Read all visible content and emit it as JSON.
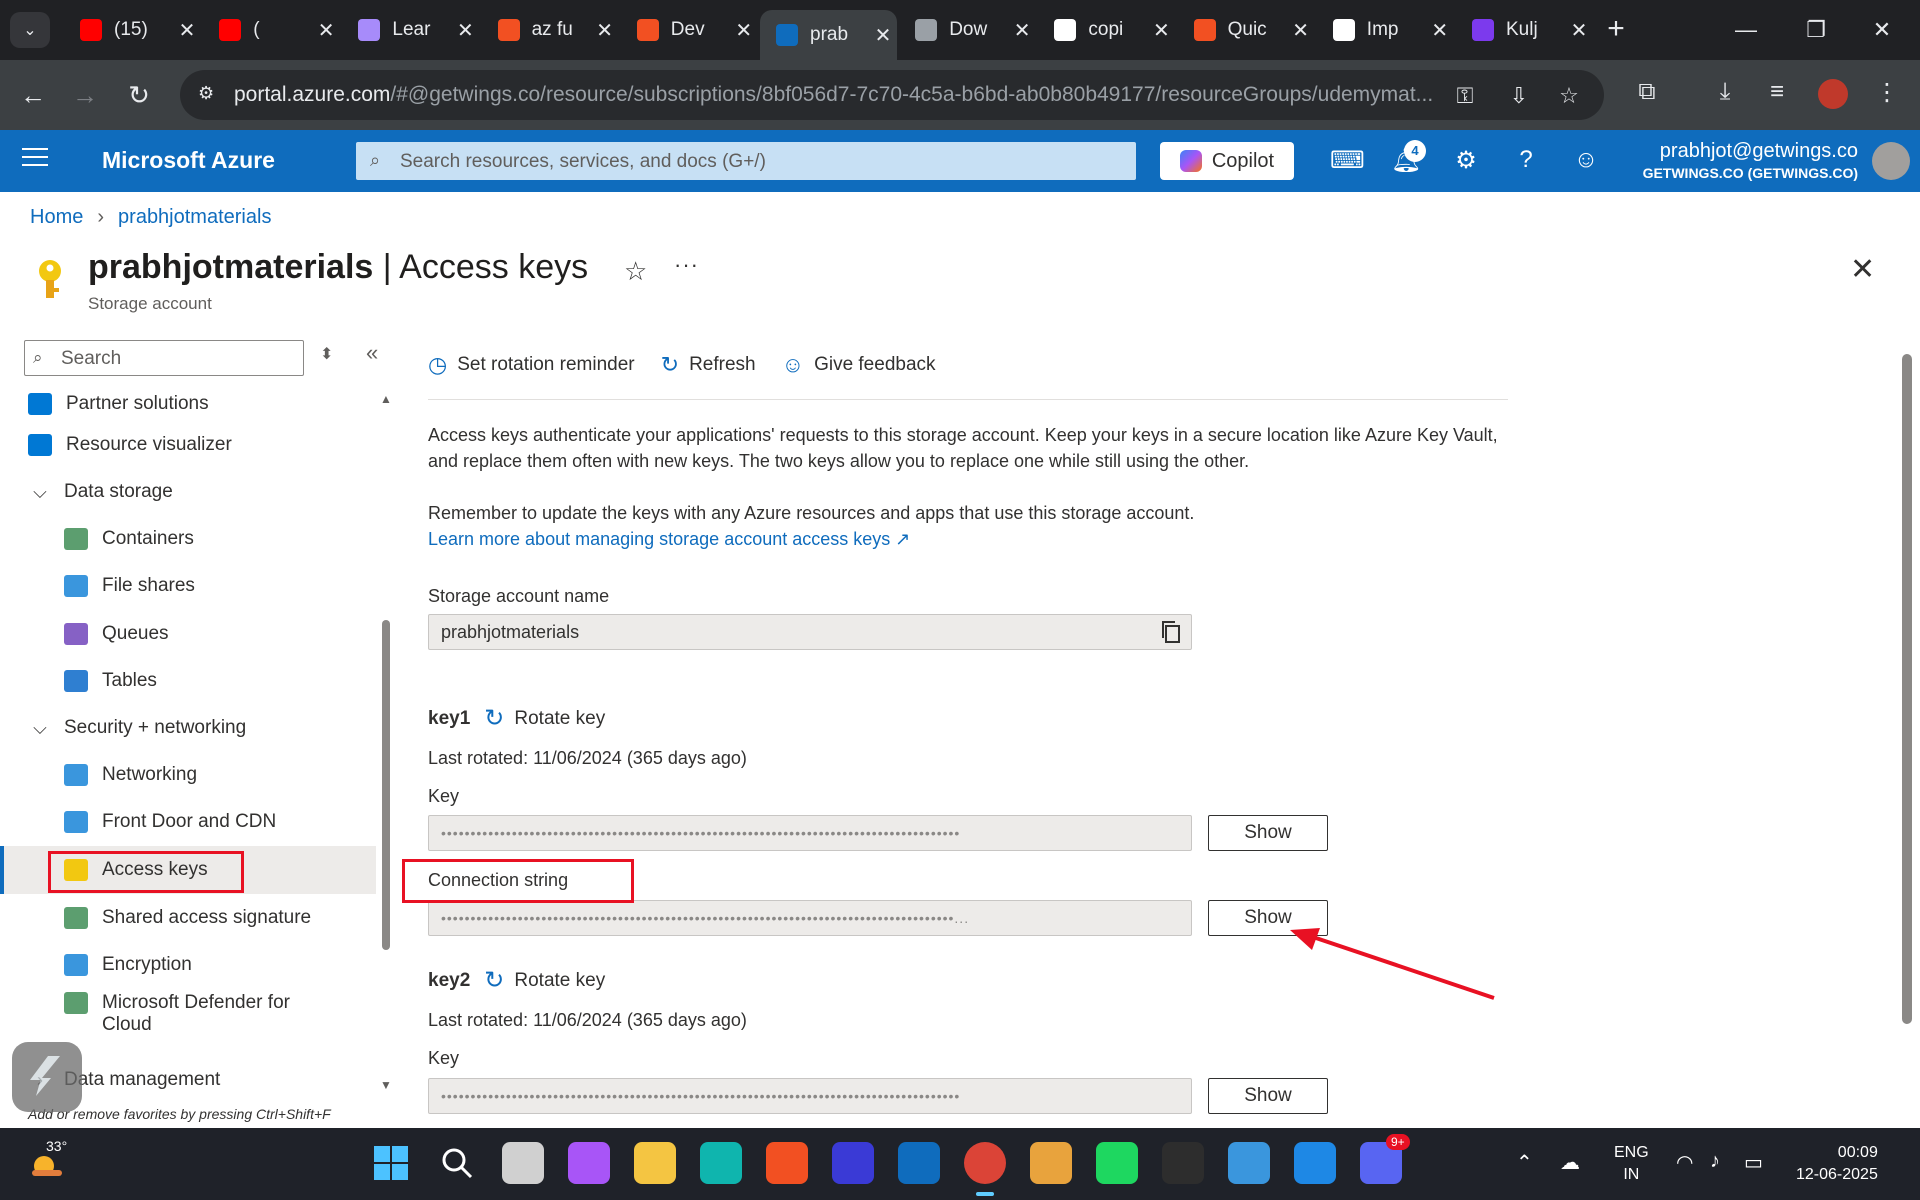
{
  "browser": {
    "tabs": [
      {
        "title": "(15)",
        "favicon_color": "#ff0000"
      },
      {
        "title": "(",
        "favicon_color": "#ff0000"
      },
      {
        "title": "Lear",
        "favicon_color": "#a78bfa"
      },
      {
        "title": "az fu",
        "favicon_color": "#f25022"
      },
      {
        "title": "Dev",
        "favicon_color": "#f25022"
      },
      {
        "title": "prab",
        "favicon_color": "#0f6cbd"
      },
      {
        "title": "Dow",
        "favicon_color": "#9aa0a6"
      },
      {
        "title": "copi",
        "favicon_color": "#ffffff"
      },
      {
        "title": "Quic",
        "favicon_color": "#f25022"
      },
      {
        "title": "Imp",
        "favicon_color": "#ffffff"
      },
      {
        "title": "Kulj",
        "favicon_color": "#7c3aed"
      }
    ],
    "active_tab_index": 5,
    "url_host": "portal.azure.com",
    "url_path": "/#@getwings.co/resource/subscriptions/8bf056d7-7c70-4c5a-b6bd-ab0b80b49177/resourceGroups/udemymat..."
  },
  "azure": {
    "brand": "Microsoft Azure",
    "search_placeholder": "Search resources, services, and docs (G+/)",
    "copilot_label": "Copilot",
    "notification_count": "4",
    "account_email": "prabhjot@getwings.co",
    "account_org": "GETWINGS.CO (GETWINGS.CO)"
  },
  "breadcrumb": [
    "Home",
    "prabhjotmaterials"
  ],
  "page": {
    "resource_name": "prabhjotmaterials",
    "blade_title": " | Access keys",
    "subtitle": "Storage account"
  },
  "nav": {
    "search_placeholder": "Search",
    "items": [
      {
        "label": "Partner solutions",
        "kind": "item",
        "indent": 0,
        "icon_color": "#0078d4"
      },
      {
        "label": "Resource visualizer",
        "kind": "item",
        "indent": 0,
        "icon_color": "#0078d4"
      },
      {
        "label": "Data storage",
        "kind": "group",
        "indent": 0
      },
      {
        "label": "Containers",
        "kind": "item",
        "indent": 1,
        "icon_color": "#5c9e6f"
      },
      {
        "label": "File shares",
        "kind": "item",
        "indent": 1,
        "icon_color": "#3a96dd"
      },
      {
        "label": "Queues",
        "kind": "item",
        "indent": 1,
        "icon_color": "#8661c5"
      },
      {
        "label": "Tables",
        "kind": "item",
        "indent": 1,
        "icon_color": "#2f7fd1"
      },
      {
        "label": "Security + networking",
        "kind": "group",
        "indent": 0
      },
      {
        "label": "Networking",
        "kind": "item",
        "indent": 1,
        "icon_color": "#3a96dd"
      },
      {
        "label": "Front Door and CDN",
        "kind": "item",
        "indent": 1,
        "icon_color": "#3a96dd"
      },
      {
        "label": "Access keys",
        "kind": "item",
        "indent": 1,
        "icon_color": "#f2c811",
        "selected": true
      },
      {
        "label": "Shared access signature",
        "kind": "item",
        "indent": 1,
        "icon_color": "#5c9e6f"
      },
      {
        "label": "Encryption",
        "kind": "item",
        "indent": 1,
        "icon_color": "#3a96dd"
      },
      {
        "label": "Microsoft Defender for",
        "label2": "Cloud",
        "kind": "item",
        "indent": 1,
        "icon_color": "#5c9e6f"
      },
      {
        "label": "Data management",
        "kind": "group-collapsed",
        "indent": 0
      }
    ],
    "favorites_hint": "Add or remove favorites by pressing Ctrl+Shift+F"
  },
  "content": {
    "commands": [
      "Set rotation reminder",
      "Refresh",
      "Give feedback"
    ],
    "intro_1": "Access keys authenticate your applications' requests to this storage account. Keep your keys in a secure location like Azure Key Vault, and replace them often with new keys. The two keys allow you to replace one while still using the other.",
    "intro_2": "Remember to update the keys with any Azure resources and apps that use this storage account.",
    "learn_more": "Learn more about managing storage account access keys",
    "account_name_label": "Storage account name",
    "account_name_value": "prabhjotmaterials",
    "key1": {
      "name": "key1",
      "rotate_label": "Rotate key",
      "last_rotated": "Last rotated: 11/06/2024 (365 days ago)",
      "key_label": "Key",
      "key_masked": "••••••••••••••••••••••••••••••••••••••••••••••••••••••••••••••••••••••••••••••••••••••••",
      "cs_label": "Connection string",
      "cs_masked": "•••••••••••••••••••••••••••••••••••••••••••••••••••••••••••••••••••••••••••••••••••••••...",
      "show_label": "Show"
    },
    "key2": {
      "name": "key2",
      "rotate_label": "Rotate key",
      "last_rotated": "Last rotated: 11/06/2024 (365 days ago)",
      "key_label": "Key",
      "key_masked": "••••••••••••••••••••••••••••••••••••••••••••••••••••••••••••••••••••••••••••••••••••••••",
      "show_label": "Show"
    }
  },
  "taskbar": {
    "temperature": "33°",
    "lang_1": "ENG",
    "lang_2": "IN",
    "time": "00:09",
    "date": "12-06-2025",
    "discord_badge": "9+",
    "apps": [
      {
        "name": "windows-start",
        "color": "#4cc2ff"
      },
      {
        "name": "search",
        "color": "#ffffff"
      },
      {
        "name": "task-view",
        "color": "#d0d0d0"
      },
      {
        "name": "copilot",
        "color": "#a855f7"
      },
      {
        "name": "file-explorer",
        "color": "#f4c542"
      },
      {
        "name": "edge",
        "color": "#0fb5ae"
      },
      {
        "name": "store",
        "color": "#f25022"
      },
      {
        "name": "powerapps",
        "color": "#3a3ad6"
      },
      {
        "name": "outlook-new",
        "color": "#0f6cbd"
      },
      {
        "name": "chrome",
        "color": "#db4437"
      },
      {
        "name": "snipping",
        "color": "#e8a33d"
      },
      {
        "name": "spotify",
        "color": "#1ed760"
      },
      {
        "name": "terminal",
        "color": "#2d2d2d"
      },
      {
        "name": "notepad",
        "color": "#3a96dd"
      },
      {
        "name": "vscode",
        "color": "#1e88e5"
      },
      {
        "name": "discord",
        "color": "#5865f2"
      }
    ]
  },
  "colors": {
    "azure_blue": "#0f6cbd",
    "highlight_red": "#e81123"
  }
}
